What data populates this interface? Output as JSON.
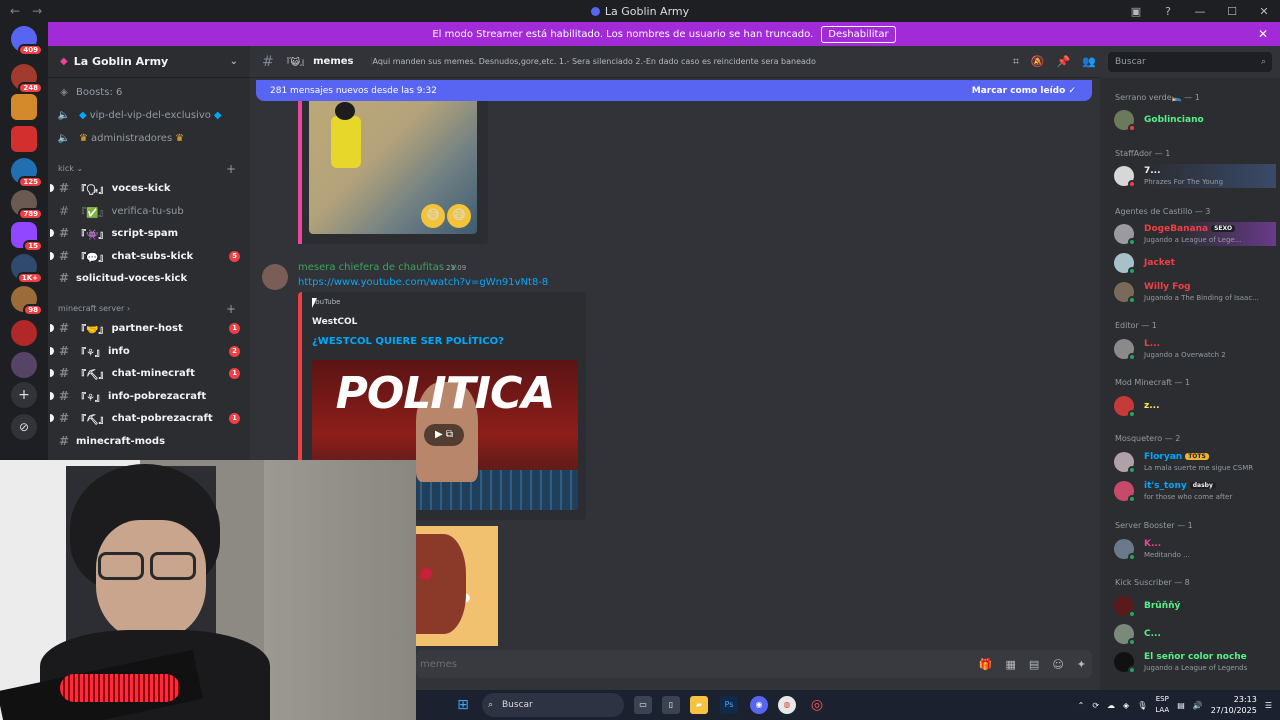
{
  "window": {
    "title": "La Goblin Army"
  },
  "banner": {
    "text": "El modo Streamer está habilitado. Los nombres de usuario se han truncado.",
    "button": "Deshabilitar"
  },
  "rail": {
    "badges": [
      "409",
      "248",
      "125",
      "789",
      "15",
      "1K+",
      "98"
    ]
  },
  "sidebar": {
    "guild_name": "La Goblin Army",
    "boosts": "Boosts: 6",
    "top_channels": [
      {
        "label": "vip-del-vip-del-exclusivo"
      },
      {
        "label": "administradores"
      }
    ],
    "categories": [
      {
        "label": "kick"
      },
      {
        "label": "minecraft server"
      }
    ],
    "channels": [
      {
        "label": "voces-kick",
        "prefix": "『🗣』",
        "count": ""
      },
      {
        "label": "verifica-tu-sub",
        "prefix": "『✅』",
        "count": ""
      },
      {
        "label": "script-spam",
        "prefix": "『👾』",
        "count": ""
      },
      {
        "label": "chat-subs-kick",
        "prefix": "『💬』",
        "count": "5"
      },
      {
        "label": "solicitud-voces-kick",
        "prefix": "",
        "count": ""
      },
      {
        "label": "partner-host",
        "prefix": "『🤝』",
        "count": "1"
      },
      {
        "label": "info",
        "prefix": "『⚘』",
        "count": "2"
      },
      {
        "label": "chat-minecraft",
        "prefix": "『⛏』",
        "count": "1"
      },
      {
        "label": "info-pobrezacraft",
        "prefix": "『⚘』",
        "count": ""
      },
      {
        "label": "chat-pobrezacraft",
        "prefix": "『⛏』",
        "count": "1"
      },
      {
        "label": "minecraft-mods",
        "prefix": "",
        "count": ""
      }
    ]
  },
  "chat": {
    "channel_prefix": "『😺』",
    "channel_name": "memes",
    "topic": "Aqui manden sus memes. Desnudos,gore,etc. 1.- Sera silenciado 2.-En dado caso es reincidente sera baneado",
    "search_placeholder": "Buscar",
    "new_messages": "281 mensajes nuevos desde las 9:32",
    "mark_read": "Marcar como leído",
    "message": {
      "author": "mesera chiefera de chaufitas :v",
      "time": "23:09",
      "link": "https://www.youtube.com/watch?v=gWn91vNt8-8",
      "embed_provider": "YouTube",
      "embed_author": "WestCOL",
      "embed_title": "¿WESTCOL QUIERE SER POLÍTICO?",
      "thumb_text": "POLITICA"
    },
    "input_placeholder": "memes"
  },
  "members": {
    "groups": [
      {
        "label": "Serrano verde🛌 — 1"
      },
      {
        "label": "StaffAdor — 1"
      },
      {
        "label": "Agentes de Castillo — 3"
      },
      {
        "label": "Editor — 1"
      },
      {
        "label": "Mod Minecraft — 1"
      },
      {
        "label": "Mosquetero — 2"
      },
      {
        "label": "Server Booster — 1"
      },
      {
        "label": "Kick Suscriber — 8"
      }
    ],
    "list": [
      {
        "name": "Goblinciano",
        "activity": "",
        "tag": "",
        "color": "#57f287"
      },
      {
        "name": "7...",
        "activity": "Phrazes For The Young",
        "tag": "",
        "color": "#f2f3f5"
      },
      {
        "name": "DogeBanana",
        "activity": "Jugando a League of Lege...",
        "tag": "SEXO",
        "color": "#f23f43"
      },
      {
        "name": "Jacket",
        "activity": "",
        "tag": "",
        "color": "#f23f43"
      },
      {
        "name": "Willy Fog",
        "activity": "Jugando a The Binding of Isaac...",
        "tag": "",
        "color": "#f23f43"
      },
      {
        "name": "L...",
        "activity": "Jugando a Overwatch 2",
        "tag": "",
        "color": "#f23f43"
      },
      {
        "name": "z...",
        "activity": "",
        "tag": "",
        "color": "#fee75c"
      },
      {
        "name": "Floryan",
        "activity": "La mala suerte me sigue CSMR",
        "tag": "TOTS",
        "color": "#00a8fc"
      },
      {
        "name": "it's_tony",
        "activity": "for those who come after",
        "tag": "dasby",
        "color": "#00a8fc"
      },
      {
        "name": "K...",
        "activity": "Meditando ...",
        "tag": "",
        "color": "#eb459e"
      },
      {
        "name": "Brûňňý",
        "activity": "",
        "tag": "",
        "color": "#57f287"
      },
      {
        "name": "C...",
        "activity": "",
        "tag": "",
        "color": "#57f287"
      },
      {
        "name": "El señor color noche",
        "activity": "Jugando a League of Legends",
        "tag": "",
        "color": "#57f287"
      }
    ]
  },
  "taskbar": {
    "search": "Buscar",
    "lang1": "ESP",
    "lang2": "LAA",
    "time": "23:13",
    "date": "27/10/2025"
  }
}
